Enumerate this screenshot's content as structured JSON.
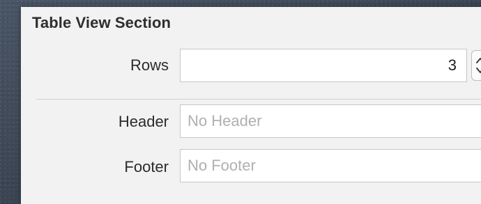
{
  "inspector": {
    "section_title": "Table View Section",
    "rows": {
      "label": "Rows",
      "value": "3",
      "stepper_icon": "stepper-icon"
    },
    "header": {
      "label": "Header",
      "placeholder": "No Header",
      "value": ""
    },
    "footer": {
      "label": "Footer",
      "placeholder": "No Footer",
      "value": ""
    }
  },
  "colors": {
    "panel_background": "#f2f2f2",
    "field_background": "#ffffff",
    "placeholder_text": "#b0b0b0",
    "label_text": "#2b2b2b",
    "desktop_background": "#3f4a5a"
  }
}
